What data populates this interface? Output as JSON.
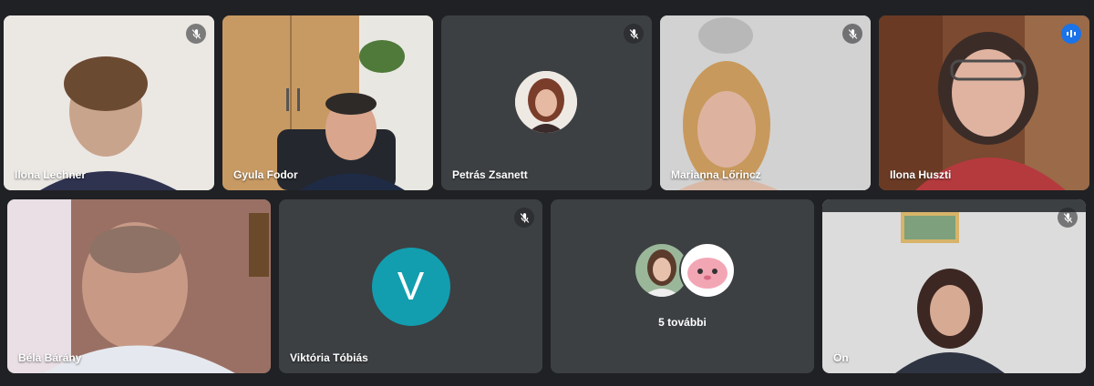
{
  "participants": [
    {
      "name": "Ilona Lechner",
      "muted": true
    },
    {
      "name": "Gyula Fodor",
      "muted": false
    },
    {
      "name": "Petrás Zsanett",
      "muted": true
    },
    {
      "name": "Marianna Lőrincz",
      "muted": true
    },
    {
      "name": "Ilona Huszti",
      "muted": false,
      "speaking": true
    },
    {
      "name": "Béla Bárány",
      "muted": false
    },
    {
      "name": "Viktória Tóbiás",
      "muted": true,
      "initial": "V"
    },
    {
      "name": "Ön",
      "muted": true
    }
  ],
  "more_tile": {
    "label": "5 további"
  },
  "icons": {
    "muted": "mic-off-icon",
    "speaking": "audio-level-icon"
  },
  "colors": {
    "background": "#202124",
    "tile": "#3c4043",
    "accent": "#8ab4f8",
    "avatar": "#129eaf",
    "speaking": "#1a73e8"
  }
}
